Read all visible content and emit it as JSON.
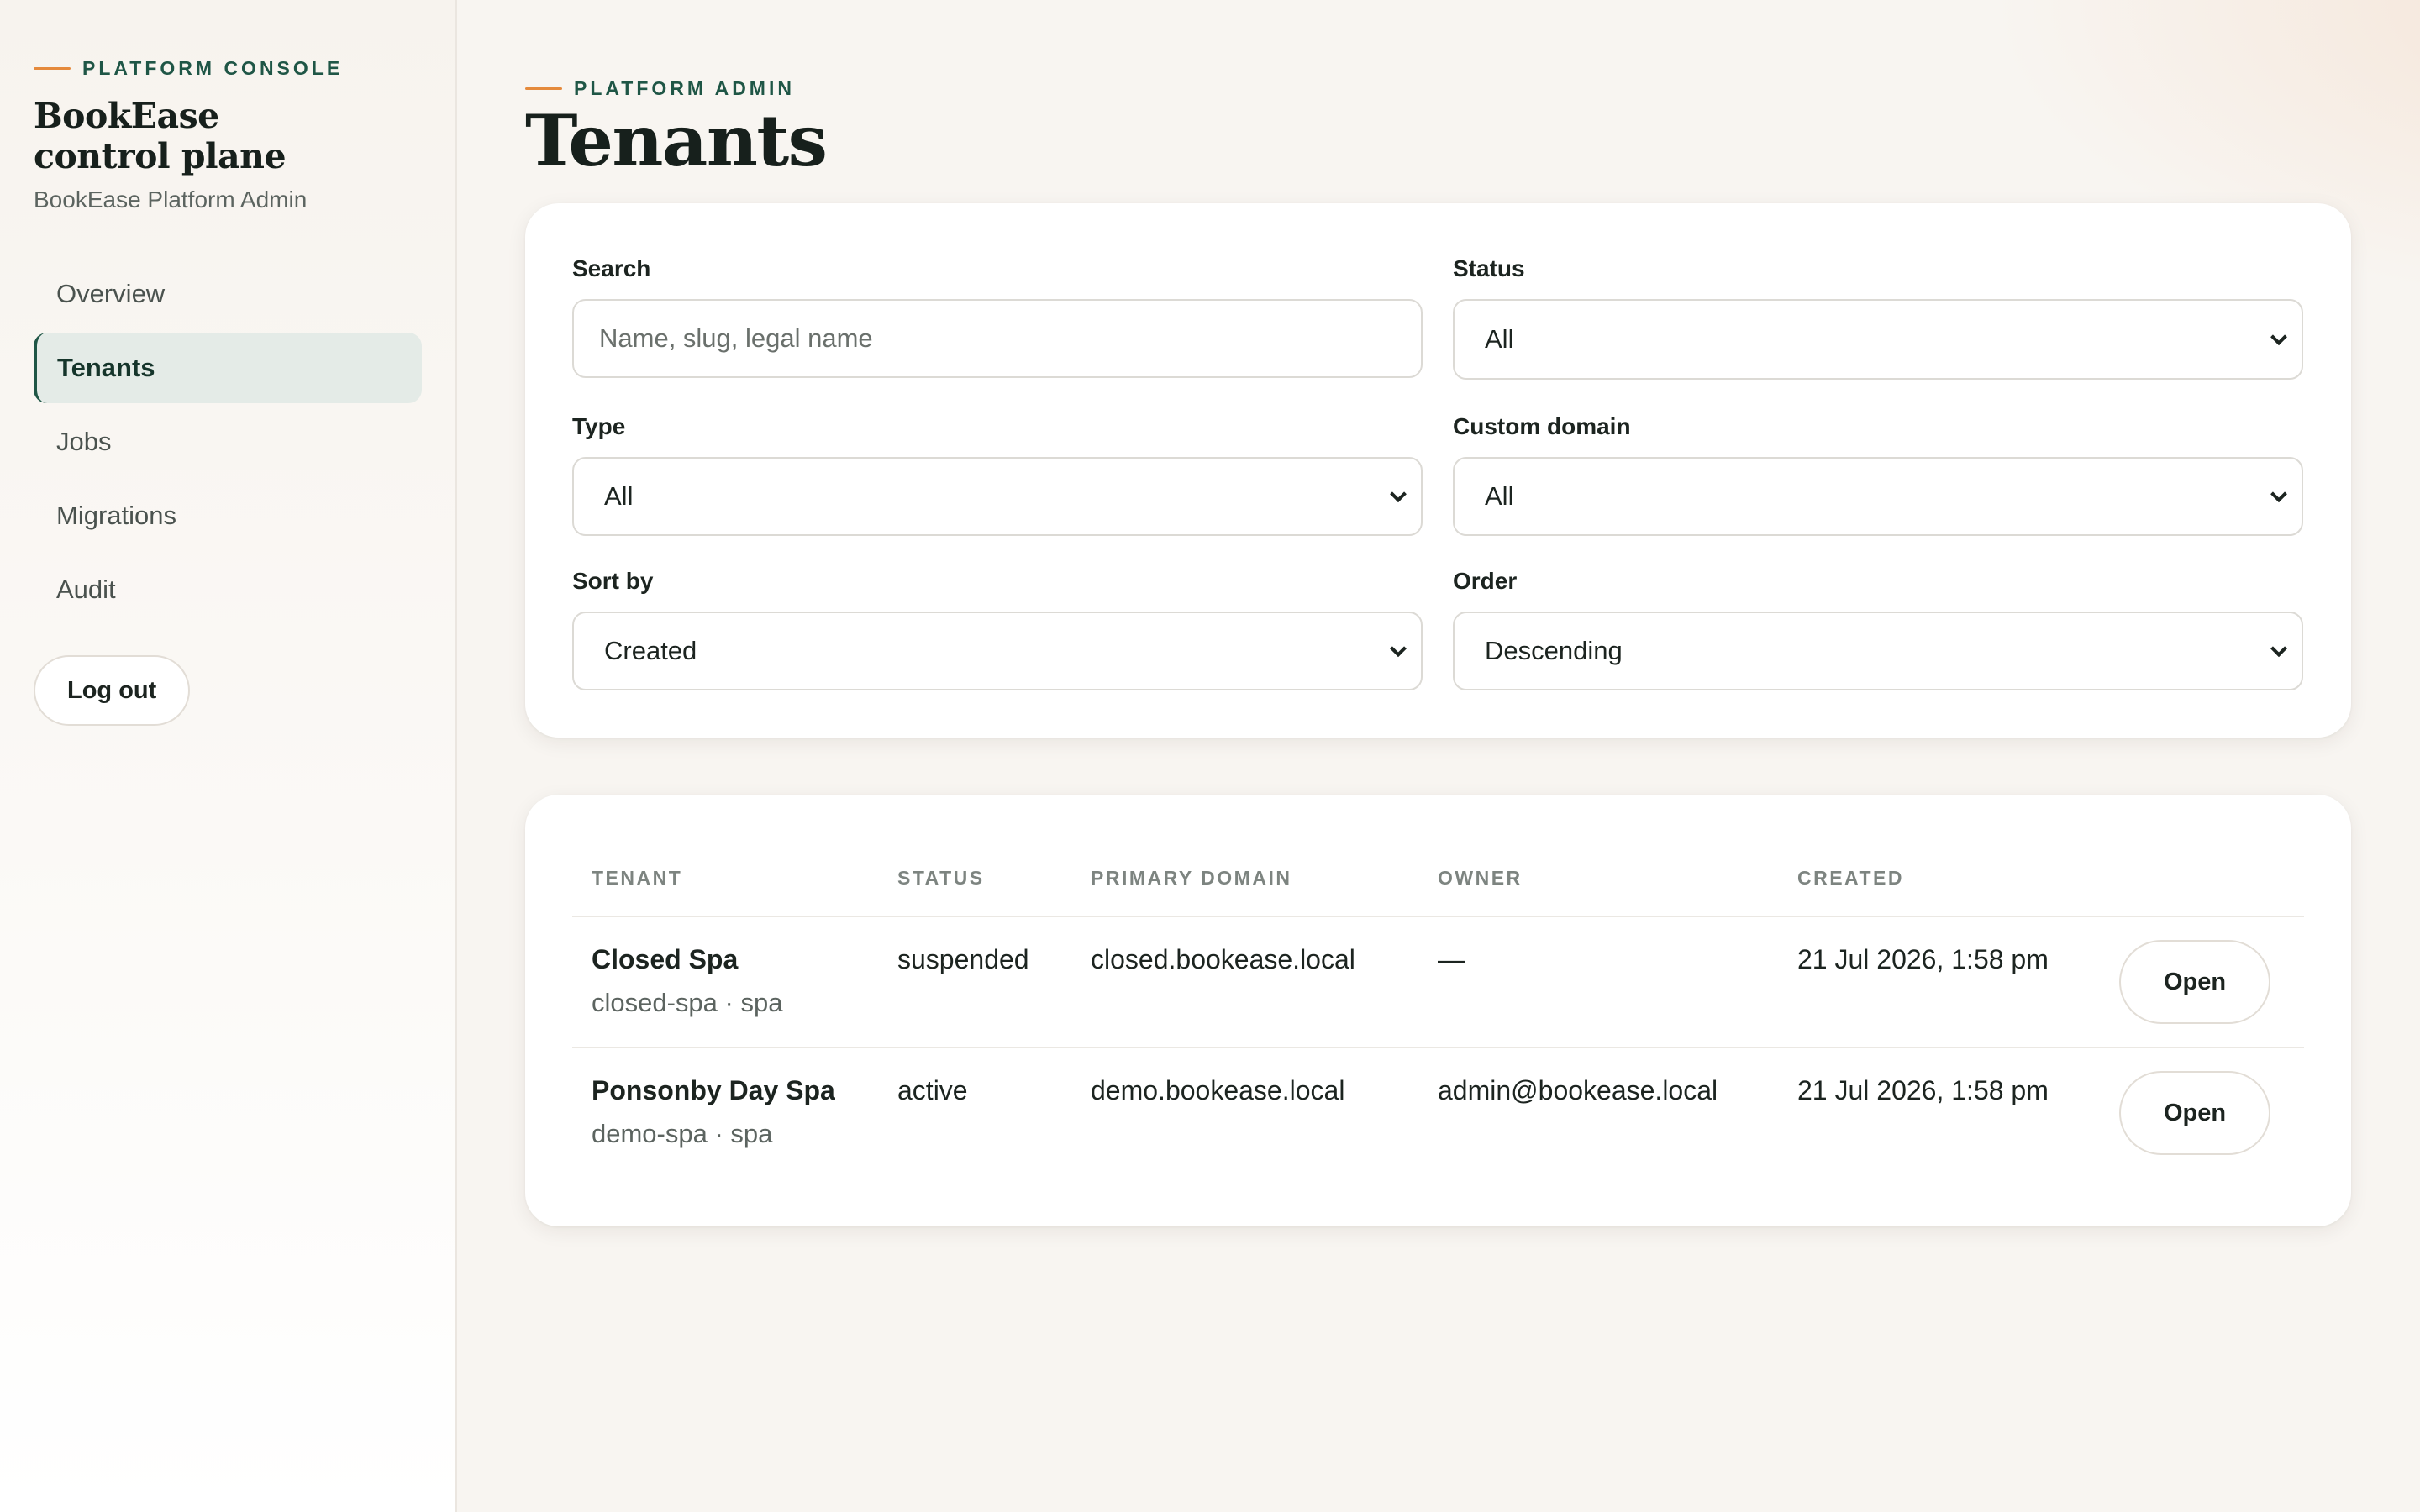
{
  "sidebar": {
    "eyebrow": "Platform console",
    "brand_line1": "BookEase",
    "brand_line2": "control plane",
    "subtitle": "BookEase Platform Admin",
    "items": [
      {
        "label": "Overview",
        "active": false
      },
      {
        "label": "Tenants",
        "active": true
      },
      {
        "label": "Jobs",
        "active": false
      },
      {
        "label": "Migrations",
        "active": false
      },
      {
        "label": "Audit",
        "active": false
      }
    ],
    "logout_label": "Log out"
  },
  "header": {
    "eyebrow": "Platform admin",
    "title": "Tenants"
  },
  "filters": {
    "search": {
      "label": "Search",
      "placeholder": "Name, slug, legal name",
      "value": ""
    },
    "status": {
      "label": "Status",
      "value": "All"
    },
    "type": {
      "label": "Type",
      "value": "All"
    },
    "custom_domain": {
      "label": "Custom domain",
      "value": "All"
    },
    "sort_by": {
      "label": "Sort by",
      "value": "Created"
    },
    "order": {
      "label": "Order",
      "value": "Descending"
    }
  },
  "table": {
    "columns": [
      "Tenant",
      "Status",
      "Primary domain",
      "Owner",
      "Created"
    ],
    "rows": [
      {
        "name": "Closed Spa",
        "meta": "closed-spa · spa",
        "status": "suspended",
        "domain": "closed.bookease.local",
        "owner": "—",
        "created": "21 Jul 2026, 1:58 pm",
        "action": "Open"
      },
      {
        "name": "Ponsonby Day Spa",
        "meta": "demo-spa · spa",
        "status": "active",
        "domain": "demo.bookease.local",
        "owner": "admin@bookease.local",
        "created": "21 Jul 2026, 1:58 pm",
        "action": "Open"
      }
    ]
  },
  "colors": {
    "accent": "#1f5646",
    "eyebrow_dash": "#e58a3c",
    "active_nav_bg": "#e4ebe7"
  }
}
